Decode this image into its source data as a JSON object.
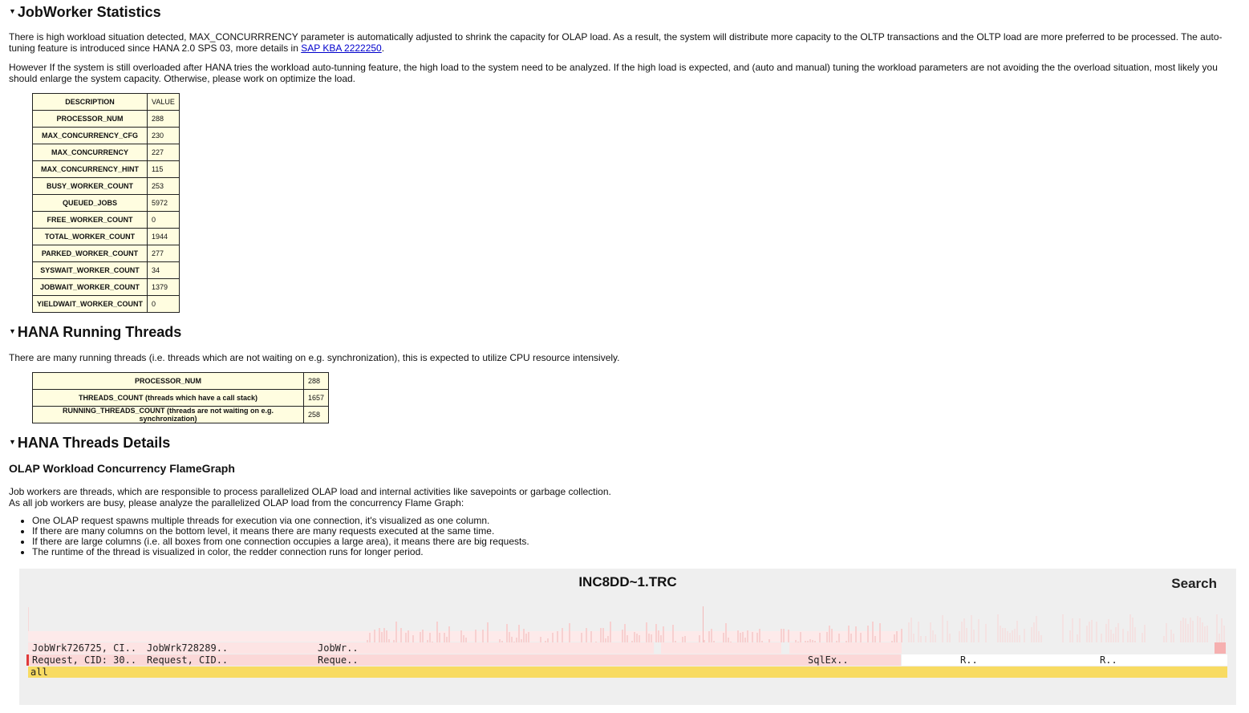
{
  "sections": {
    "jobworker": {
      "title": "JobWorker Statistics",
      "p1": "There is high workload situation detected, MAX_CONCURRRENCY parameter is automatically adjusted to shrink the capacity for OLAP load. As a result, the system will distribute more capacity to the OLTP transactions and the OLTP load are more preferred to be processed. The auto-tuning feature is introduced since HANA 2.0 SPS 03, more details in ",
      "p1_link": "SAP KBA 2222250",
      "p1_end": ".",
      "p2": "However If the system is still overloaded after HANA tries the workload auto-tunning feature, the high load to the system need to be analyzed. If the high load is expected, and (auto and manual) tuning the workload parameters are not avoiding the the overload situation, most likely you should enlarge the system capacity. Otherwise, please work on optimize the load.",
      "table_headers": [
        "DESCRIPTION",
        "VALUE"
      ],
      "rows": [
        {
          "desc": "PROCESSOR_NUM",
          "value": "288"
        },
        {
          "desc": "MAX_CONCURRENCY_CFG",
          "value": "230"
        },
        {
          "desc": "MAX_CONCURRENCY",
          "value": "227"
        },
        {
          "desc": "MAX_CONCURRENCY_HINT",
          "value": "115"
        },
        {
          "desc": "BUSY_WORKER_COUNT",
          "value": "253"
        },
        {
          "desc": "QUEUED_JOBS",
          "value": "5972"
        },
        {
          "desc": "FREE_WORKER_COUNT",
          "value": "0"
        },
        {
          "desc": "TOTAL_WORKER_COUNT",
          "value": "1944"
        },
        {
          "desc": "PARKED_WORKER_COUNT",
          "value": "277"
        },
        {
          "desc": "SYSWAIT_WORKER_COUNT",
          "value": "34"
        },
        {
          "desc": "JOBWAIT_WORKER_COUNT",
          "value": "1379"
        },
        {
          "desc": "YIELDWAIT_WORKER_COUNT",
          "value": "0"
        }
      ]
    },
    "running": {
      "title": "HANA Running Threads",
      "p1": "There are many running threads (i.e. threads which are not waiting on e.g. synchronization), this is expected to utilize CPU resource intensively.",
      "rows": [
        {
          "desc": "PROCESSOR_NUM",
          "value": "288"
        },
        {
          "desc": "THREADS_COUNT (threads which have a call stack)",
          "value": "1657"
        },
        {
          "desc": "RUNNING_THREADS_COUNT (threads are not waiting on e.g. synchronization)",
          "value": "258"
        }
      ]
    },
    "details": {
      "title": "HANA Threads Details",
      "subtitle": "OLAP Workload Concurrency FlameGraph",
      "p1_line1": "Job workers are threads, which are responsible to process parallelized OLAP load and internal activities like savepoints or garbage collection.",
      "p1_line2": "As all job workers are busy, please analyze the parallelized OLAP load from the concurrency Flame Graph:",
      "bullets": [
        "One OLAP request spawns multiple threads for execution via one connection, it's visualized as one column.",
        "If there are many columns on the bottom level, it means there are many requests executed at the same time.",
        "If there are large columns (i.e. all boxes from one connection occupies a large area), it means there are big requests.",
        "The runtime of the thread is visualized in color, the redder connection runs for longer period."
      ]
    }
  },
  "flamegraph": {
    "title": "INC8DD~1.TRC",
    "search_label": "Search",
    "labels": {
      "root": "all",
      "req1": "Request, CID: 30..",
      "req2": "Request, CID..",
      "req3": "Reque..",
      "sql1": "SqlEx..",
      "r1": "R..",
      "r2": "R..",
      "job1": "JobWrk726725, CI..",
      "job2": "JobWrk728289..",
      "job3": "JobWr.."
    },
    "colors": {
      "background": "#efefef",
      "root": "#f8db62",
      "request": "#fbd8d8",
      "worker": "#fde4e4",
      "accent": "#e03a3a"
    }
  }
}
